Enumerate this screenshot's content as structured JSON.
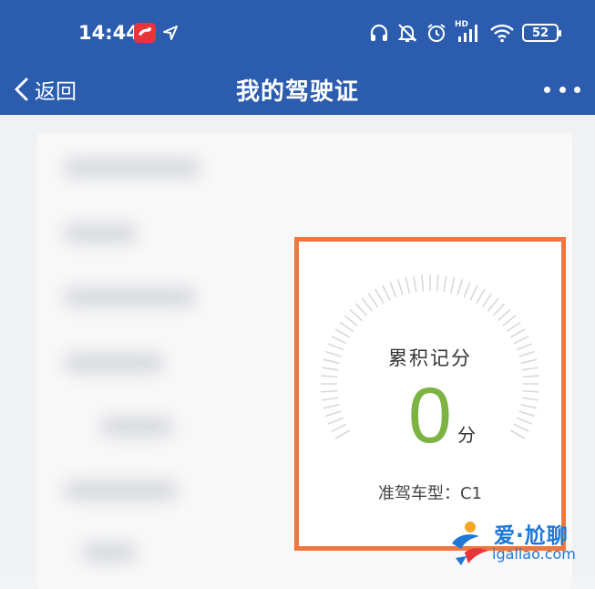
{
  "status_bar": {
    "time": "14:44",
    "hd_label": "HD",
    "battery_level": "52",
    "icons": [
      "headset-icon",
      "bell-muted-icon",
      "alarm-icon",
      "signal-icon",
      "wifi-icon",
      "battery-icon"
    ]
  },
  "nav": {
    "back_label": "返回",
    "title": "我的驾驶证",
    "more_icon": "more-dots-icon"
  },
  "points_card": {
    "label": "累积记分",
    "value": "0",
    "unit": "分",
    "license_class": "准驾车型：C1",
    "highlight_color": "#f0763e",
    "value_color": "#7cb342"
  },
  "watermark": {
    "title": "爱·尬聊",
    "url": "igaliao.com"
  },
  "colors": {
    "header": "#2b5cad",
    "background": "#f0f1f3"
  }
}
